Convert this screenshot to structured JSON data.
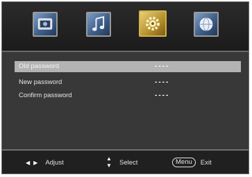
{
  "menu_tabs": [
    {
      "id": "picture",
      "icon": "picture-icon",
      "selected": false
    },
    {
      "id": "sound",
      "icon": "music-note-icon",
      "selected": false
    },
    {
      "id": "setup",
      "icon": "gear-icon",
      "selected": true
    },
    {
      "id": "channel",
      "icon": "globe-icon",
      "selected": false
    }
  ],
  "password_form": {
    "rows": [
      {
        "label": "Old password",
        "value": "----",
        "selected": true
      },
      {
        "label": "New password",
        "value": "----",
        "selected": false
      },
      {
        "label": "Confirm password",
        "value": "----",
        "selected": false
      }
    ]
  },
  "footer": {
    "adjust": {
      "left_glyph": "◀",
      "right_glyph": "▶",
      "label": "Adjust"
    },
    "select": {
      "up_glyph": "▲",
      "down_glyph": "▼",
      "label": "Select"
    },
    "exit": {
      "key_label": "Menu",
      "label": "Exit"
    }
  },
  "colors": {
    "panel_bg": "#383838",
    "selected_row_bg": "#b3b3b3",
    "setup_tab_border": "#d2b24a"
  }
}
